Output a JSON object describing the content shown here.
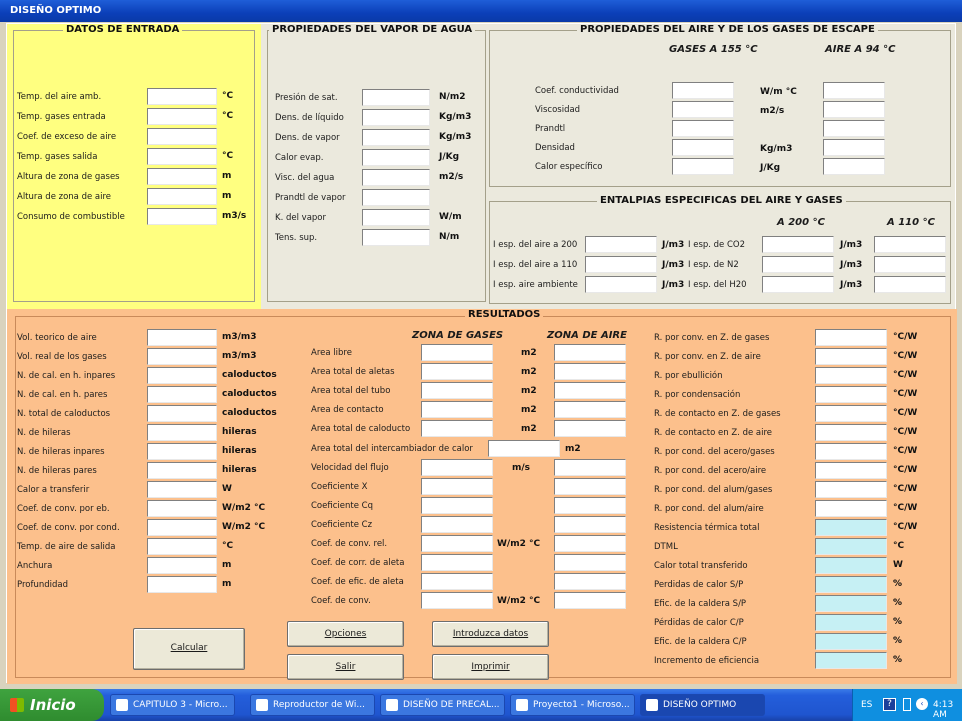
{
  "window": {
    "title": "DISEÑO OPTIMO"
  },
  "datos": {
    "title": "DATOS DE ENTRADA",
    "rows": [
      {
        "label": "Temp. del aire amb.",
        "unit": "°C"
      },
      {
        "label": "Temp. gases entrada",
        "unit": "°C"
      },
      {
        "label": "Coef. de exceso de aire",
        "unit": ""
      },
      {
        "label": "Temp. gases salida",
        "unit": "°C"
      },
      {
        "label": "Altura de zona de gases",
        "unit": "m"
      },
      {
        "label": "Altura de zona de aire",
        "unit": "m"
      },
      {
        "label": "Consumo de combustible",
        "unit": "m3/s"
      }
    ]
  },
  "vapor": {
    "title": "PROPIEDADES DEL VAPOR DE AGUA",
    "rows": [
      {
        "label": "Presión de sat.",
        "unit": "N/m2"
      },
      {
        "label": "Dens. de líquido",
        "unit": "Kg/m3"
      },
      {
        "label": "Dens. de vapor",
        "unit": "Kg/m3"
      },
      {
        "label": "Calor evap.",
        "unit": "J/Kg"
      },
      {
        "label": "Visc. del agua",
        "unit": "m2/s"
      },
      {
        "label": "Prandtl de vapor",
        "unit": ""
      },
      {
        "label": "K. del vapor",
        "unit": "W/m"
      },
      {
        "label": "Tens. sup.",
        "unit": "N/m"
      }
    ]
  },
  "aire": {
    "title": "PROPIEDADES DEL AIRE Y DE LOS GASES DE ESCAPE",
    "col_gases": "GASES A 155 °C",
    "col_aire": "AIRE A 94 °C",
    "rows": [
      {
        "label": "Coef. conductividad",
        "unit": "W/m °C"
      },
      {
        "label": "Viscosidad",
        "unit": "m2/s"
      },
      {
        "label": "Prandtl",
        "unit": ""
      },
      {
        "label": "Densidad",
        "unit": "Kg/m3"
      },
      {
        "label": "Calor específico",
        "unit": "J/Kg"
      }
    ]
  },
  "entalpias": {
    "title": "ENTALPIAS ESPECIFICAS DEL AIRE Y GASES",
    "col1": "A 200 °C",
    "col2": "A 110 °C",
    "left": [
      {
        "label": "I esp. del aire a 200",
        "unit": "J/m3"
      },
      {
        "label": "I esp. del aire a 110",
        "unit": "J/m3"
      },
      {
        "label": "I esp. aire ambiente",
        "unit": "J/m3"
      }
    ],
    "right": [
      {
        "label": "I esp. de CO2",
        "unit": "J/m3"
      },
      {
        "label": "I esp. de N2",
        "unit": "J/m3"
      },
      {
        "label": "I esp. del H20",
        "unit": "J/m3"
      }
    ]
  },
  "resultados": {
    "title": "RESULTADOS",
    "left": [
      {
        "label": "Vol. teorico de aire",
        "unit": "m3/m3"
      },
      {
        "label": "Vol. real de los gases",
        "unit": "m3/m3"
      },
      {
        "label": "N. de cal. en h. inpares",
        "unit": "caloductos"
      },
      {
        "label": "N. de cal. en h. pares",
        "unit": "caloductos"
      },
      {
        "label": "N. total de caloductos",
        "unit": "caloductos"
      },
      {
        "label": "N. de hileras",
        "unit": "hileras"
      },
      {
        "label": "N. de hileras inpares",
        "unit": "hileras"
      },
      {
        "label": "N. de hileras pares",
        "unit": "hileras"
      },
      {
        "label": "Calor a transferir",
        "unit": "W"
      },
      {
        "label": "Coef. de conv. por eb.",
        "unit": "W/m2 °C"
      },
      {
        "label": "Coef. de conv. por cond.",
        "unit": "W/m2 °C"
      },
      {
        "label": "Temp. de aire de salida",
        "unit": "°C"
      },
      {
        "label": "Anchura",
        "unit": "m"
      },
      {
        "label": "Profundidad",
        "unit": "m"
      }
    ],
    "zona_gases": "ZONA DE GASES",
    "zona_aire": "ZONA DE AIRE",
    "mid": [
      {
        "label": "Area libre",
        "unit": "m2"
      },
      {
        "label": "Area total de aletas",
        "unit": "m2"
      },
      {
        "label": "Area total del tubo",
        "unit": "m2"
      },
      {
        "label": "Area de contacto",
        "unit": "m2"
      },
      {
        "label": "Area total de caloducto",
        "unit": "m2"
      }
    ],
    "intercambiador": {
      "label": "Area total del intercambiador de calor",
      "unit": "m2"
    },
    "mid2": [
      {
        "label": "Velocidad del flujo",
        "unit": "m/s"
      },
      {
        "label": "Coeficiente X",
        "unit": ""
      },
      {
        "label": "Coeficiente Cq",
        "unit": ""
      },
      {
        "label": "Coeficiente Cz",
        "unit": ""
      },
      {
        "label": "Coef. de conv. rel.",
        "unit": "W/m2 °C"
      },
      {
        "label": "Coef. de corr. de aleta",
        "unit": ""
      },
      {
        "label": "Coef. de efic. de aleta",
        "unit": ""
      },
      {
        "label": "Coef. de conv.",
        "unit": "W/m2 °C"
      }
    ],
    "right": [
      {
        "label": "R. por conv. en Z. de gases",
        "unit": "°C/W"
      },
      {
        "label": "R. por conv. en Z. de aire",
        "unit": "°C/W"
      },
      {
        "label": "R. por ebullición",
        "unit": "°C/W"
      },
      {
        "label": "R. por condensación",
        "unit": "°C/W"
      },
      {
        "label": "R. de contacto en Z. de gases",
        "unit": "°C/W"
      },
      {
        "label": "R. de contacto en Z. de aire",
        "unit": "°C/W"
      },
      {
        "label": "R. por cond. del acero/gases",
        "unit": "°C/W"
      },
      {
        "label": "R. por cond. del acero/aire",
        "unit": "°C/W"
      },
      {
        "label": "R. por cond. del alum/gases",
        "unit": "°C/W"
      },
      {
        "label": "R. por cond. del alum/aire",
        "unit": "°C/W"
      },
      {
        "label": "Resistencia térmica total",
        "unit": "°C/W"
      },
      {
        "label": "DTML",
        "unit": "°C"
      },
      {
        "label": "Calor total transferido",
        "unit": "W"
      },
      {
        "label": "Perdidas de calor S/P",
        "unit": "%"
      },
      {
        "label": "Efic. de la caldera S/P",
        "unit": "%"
      },
      {
        "label": "Pérdidas de calor C/P",
        "unit": "%"
      },
      {
        "label": "Efic. de la caldera C/P",
        "unit": "%"
      },
      {
        "label": "Incremento de eficiencia",
        "unit": "%"
      }
    ]
  },
  "buttons": {
    "calcular": "Calcular",
    "opciones": "Opciones",
    "introduzca": "Introduzca datos",
    "salir": "Salir",
    "imprimir": "Imprimir"
  },
  "taskbar": {
    "start": "Inicio",
    "items": [
      "CAPITULO 3 - Micro...",
      "Reproductor de Wi...",
      "DISEÑO DE PRECAL...",
      "Proyecto1 - Microso...",
      "DISEÑO OPTIMO"
    ],
    "lang": "ES",
    "clock": "4:13 AM"
  },
  "colors": {
    "datos_bg": "#ffff80",
    "vapor_bg": "#ebe9dd",
    "aire_bg": "#ebe9dd",
    "resultados_bg": "#fcc08c",
    "cyan_field": "#c6f0f4",
    "titlebar": "#0b3fb8"
  }
}
